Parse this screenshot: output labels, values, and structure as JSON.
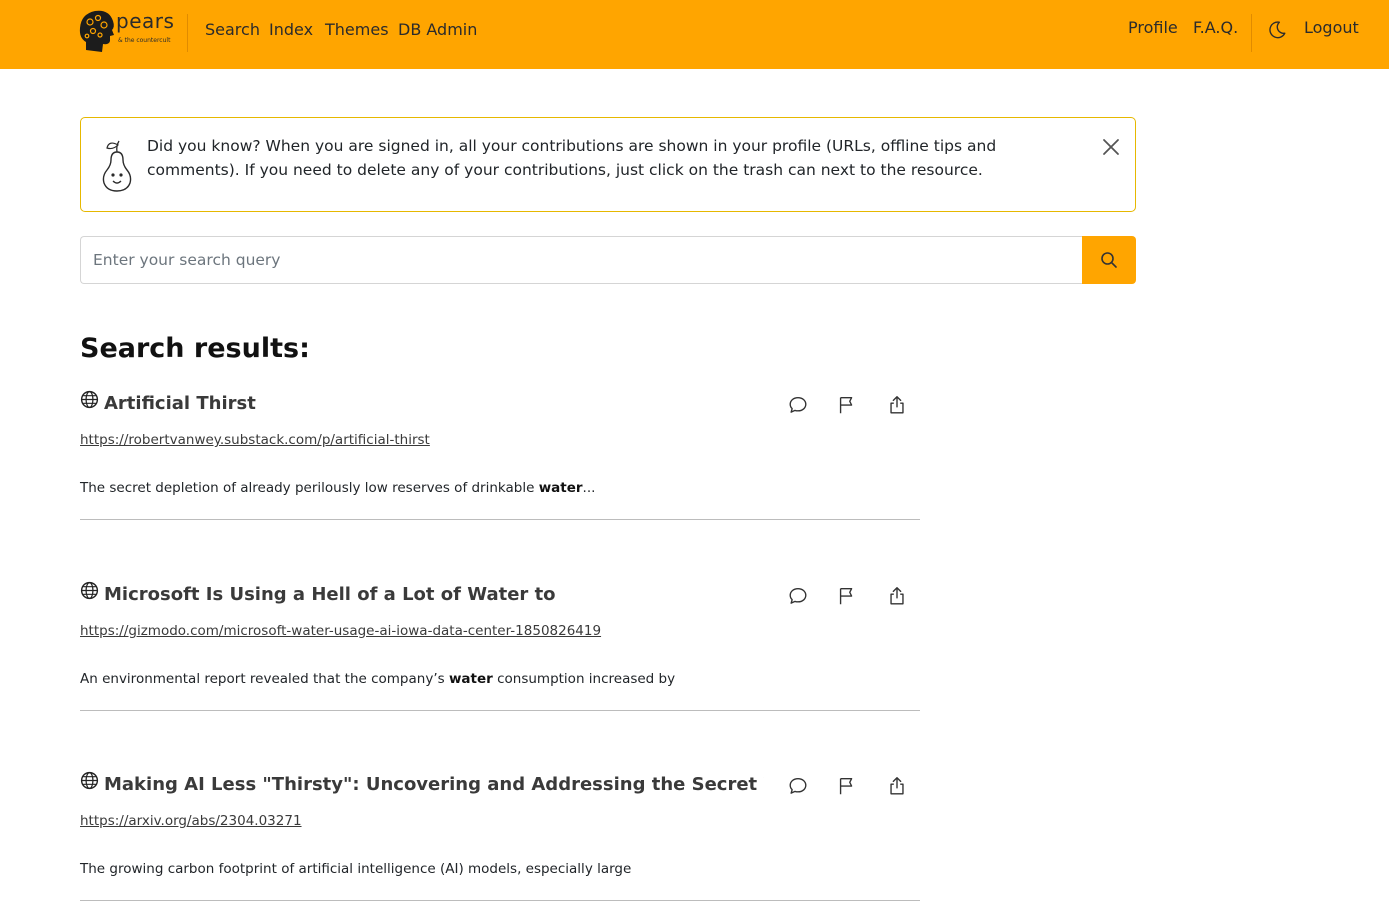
{
  "nav": {
    "brand_word": "pears",
    "brand_sub": "& the countercult",
    "links_left": [
      "Search",
      "Index",
      "Themes",
      "DB Admin"
    ],
    "links_right": [
      "Profile",
      "F.A.Q."
    ],
    "logout": "Logout"
  },
  "alert": {
    "text": "Did you know? When you are signed in, all your contributions are shown in your profile (URLs, offline tips and comments). If you need to delete any of your contributions, just click on the trash can next to the resource."
  },
  "search": {
    "placeholder": "Enter your search query"
  },
  "results_heading": "Search results:",
  "results": [
    {
      "title": "Artificial Thirst",
      "url": "https://robertvanwey.substack.com/p/artificial-thirst",
      "snippet_before": "The secret depletion of already perilously low reserves of drinkable ",
      "snippet_bold": "water",
      "snippet_after": "..."
    },
    {
      "title": "Microsoft Is Using a Hell of a Lot of Water to",
      "url": "https://gizmodo.com/microsoft-water-usage-ai-iowa-data-center-1850826419",
      "snippet_before": "An environmental report revealed that the company’s ",
      "snippet_bold": "water",
      "snippet_after": " consumption increased by"
    },
    {
      "title": "Making AI Less \"Thirsty\": Uncovering and Addressing the Secret Water F",
      "url": "https://arxiv.org/abs/2304.03271",
      "snippet_before": "The growing carbon footprint of artificial intelligence (AI) models, especially large",
      "snippet_bold": "",
      "snippet_after": ""
    }
  ],
  "colors": {
    "accent": "#ffa500",
    "alert_border": "#e6b800"
  },
  "icons": {
    "theme_toggle": "moon-icon",
    "close": "close-icon",
    "search": "search-icon",
    "result_type": "globe-icon",
    "actions": [
      "comment-icon",
      "flag-icon",
      "share-icon"
    ]
  }
}
